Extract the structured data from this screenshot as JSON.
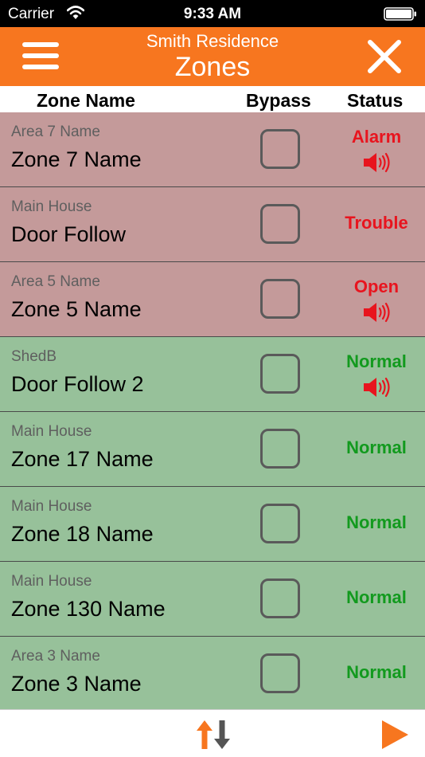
{
  "status_bar": {
    "carrier": "Carrier",
    "time": "9:33 AM"
  },
  "header": {
    "subtitle": "Smith Residence",
    "title": "Zones"
  },
  "columns": {
    "zone_name": "Zone Name",
    "bypass": "Bypass",
    "status": "Status"
  },
  "colors": {
    "nav_orange": "#f7761f",
    "alarm_row": "#c49a9a",
    "normal_row": "#97c19a",
    "status_red": "#e8141e",
    "status_green": "#129a1e",
    "sort_up": "#f7761f",
    "sort_down": "#555555"
  },
  "zones": [
    {
      "area": "Area 7 Name",
      "name": "Zone 7 Name",
      "status": "Alarm",
      "state": "alarm",
      "sounding": true,
      "bypassed": false
    },
    {
      "area": "Main House",
      "name": "Door Follow",
      "status": "Trouble",
      "state": "alarm",
      "sounding": false,
      "bypassed": false
    },
    {
      "area": "Area 5 Name",
      "name": "Zone 5 Name",
      "status": "Open",
      "state": "alarm",
      "sounding": true,
      "bypassed": false
    },
    {
      "area": "ShedB",
      "name": "Door Follow 2",
      "status": "Normal",
      "state": "normal",
      "sounding": true,
      "bypassed": false
    },
    {
      "area": "Main House",
      "name": "Zone 17 Name",
      "status": "Normal",
      "state": "normal",
      "sounding": false,
      "bypassed": false
    },
    {
      "area": "Main House",
      "name": "Zone 18 Name",
      "status": "Normal",
      "state": "normal",
      "sounding": false,
      "bypassed": false
    },
    {
      "area": "Main House",
      "name": "Zone 130 Name",
      "status": "Normal",
      "state": "normal",
      "sounding": false,
      "bypassed": false
    },
    {
      "area": "Area 3 Name",
      "name": "Zone 3 Name",
      "status": "Normal",
      "state": "normal",
      "sounding": false,
      "bypassed": false
    }
  ],
  "icons": {
    "menu": "hamburger-menu-icon",
    "close": "close-x-icon",
    "speaker": "speaker-sound-icon",
    "sort": "sort-up-down-arrows-icon",
    "play": "play-triangle-icon"
  }
}
